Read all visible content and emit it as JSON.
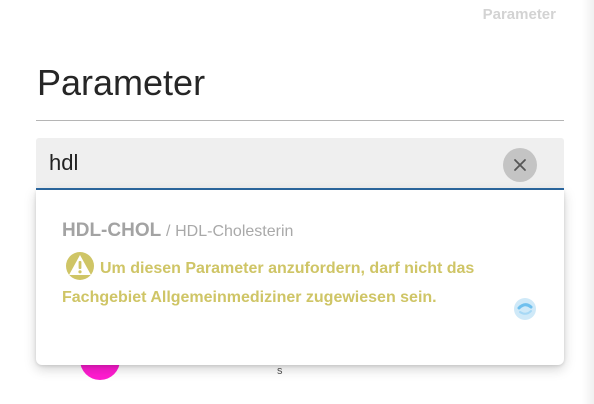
{
  "header": {
    "breadcrumb": "Parameter",
    "page_title": "Parameter"
  },
  "search": {
    "value": "hdl",
    "clear_icon": "close-icon"
  },
  "results": [
    {
      "code": "HDL-CHOL",
      "separator": "/",
      "description": "HDL-Cholesterin",
      "warning_icon": "warning-triangle-icon",
      "warning_text": "Um diesen Parameter anzufordern, darf nicht das Fachgebiet Allgemeinmediziner zugewiesen sein."
    }
  ],
  "background_row": {
    "letter": "s"
  },
  "colors": {
    "accent": "#2d6aa3",
    "warning": "#cfc566",
    "avatar": "#ff1cd1",
    "muted_text": "#a9a9a9"
  }
}
